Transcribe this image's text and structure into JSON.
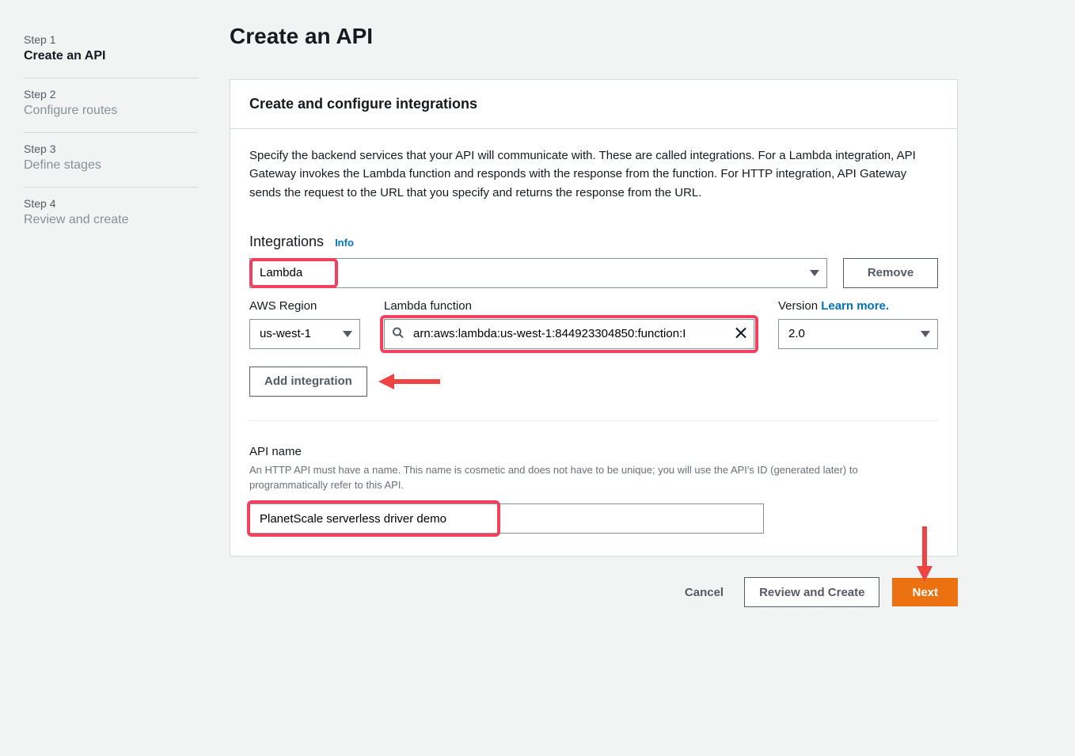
{
  "sidebar": {
    "steps": [
      {
        "num": "Step 1",
        "title": "Create an API"
      },
      {
        "num": "Step 2",
        "title": "Configure routes"
      },
      {
        "num": "Step 3",
        "title": "Define stages"
      },
      {
        "num": "Step 4",
        "title": "Review and create"
      }
    ]
  },
  "page": {
    "title": "Create an API"
  },
  "panel": {
    "header": "Create and configure integrations",
    "description": "Specify the backend services that your API will communicate with. These are called integrations. For a Lambda integration, API Gateway invokes the Lambda function and responds with the response from the function. For HTTP integration, API Gateway sends the request to the URL that you specify and returns the response from the URL.",
    "integrations_heading": "Integrations",
    "info_label": "Info",
    "integration_type": "Lambda",
    "remove_label": "Remove",
    "region_label": "AWS Region",
    "region_value": "us-west-1",
    "lambda_label": "Lambda function",
    "lambda_value": "arn:aws:lambda:us-west-1:844923304850:function:I",
    "version_label": "Version ",
    "learn_more": "Learn more.",
    "version_value": "2.0",
    "add_integration_label": "Add integration",
    "api_name_label": "API name",
    "api_name_help": "An HTTP API must have a name. This name is cosmetic and does not have to be unique; you will use the API's ID (generated later) to programmatically refer to this API.",
    "api_name_value": "PlanetScale serverless driver demo"
  },
  "footer": {
    "cancel": "Cancel",
    "review": "Review and Create",
    "next": "Next"
  }
}
